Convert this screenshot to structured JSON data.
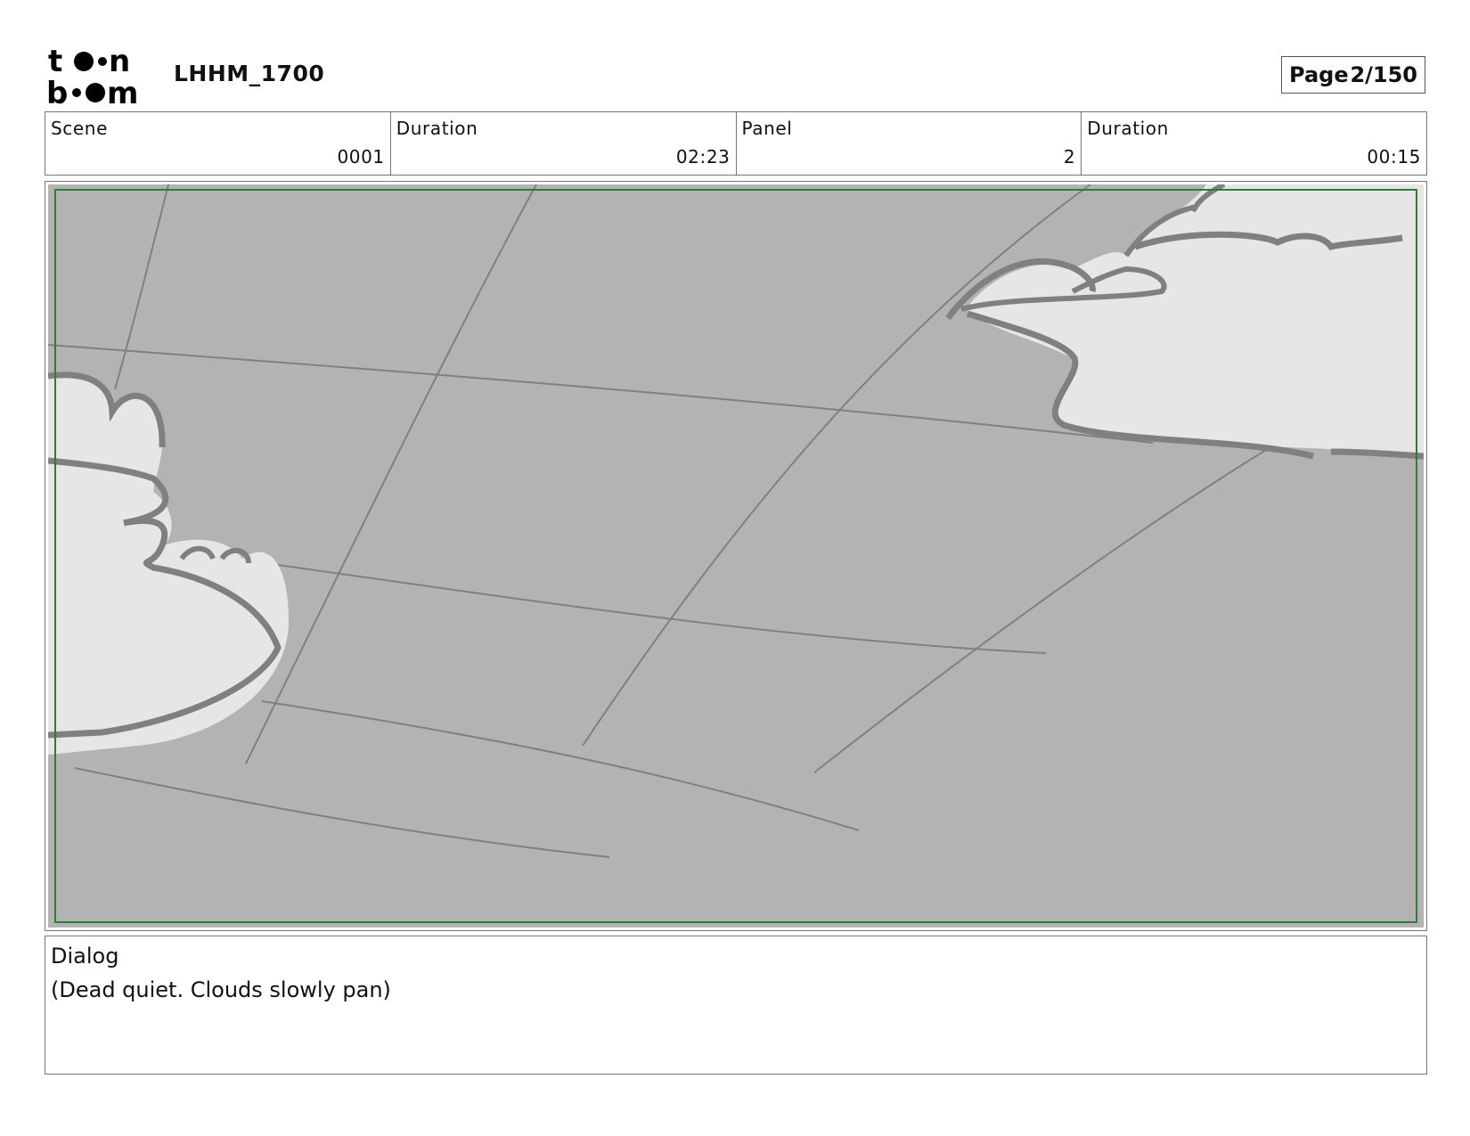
{
  "header": {
    "logo_text": "toon boom",
    "project_title": "LHHM_1700",
    "page_label": "Page",
    "page_value": "2/150"
  },
  "info": {
    "scene": {
      "label": "Scene",
      "value": "0001"
    },
    "scene_duration": {
      "label": "Duration",
      "value": "02:23"
    },
    "panel": {
      "label": "Panel",
      "value": "2"
    },
    "panel_duration": {
      "label": "Duration",
      "value": "00:15"
    }
  },
  "panel_image": {
    "description_icon": "storyboard-sketch",
    "sky_color": "#b3b3b3",
    "cloud_color": "#e6e6e6",
    "line_color": "#808080",
    "safe_frame_color": "#2e7d32"
  },
  "dialog": {
    "label": "Dialog",
    "text": "(Dead quiet.  Clouds slowly pan)"
  }
}
